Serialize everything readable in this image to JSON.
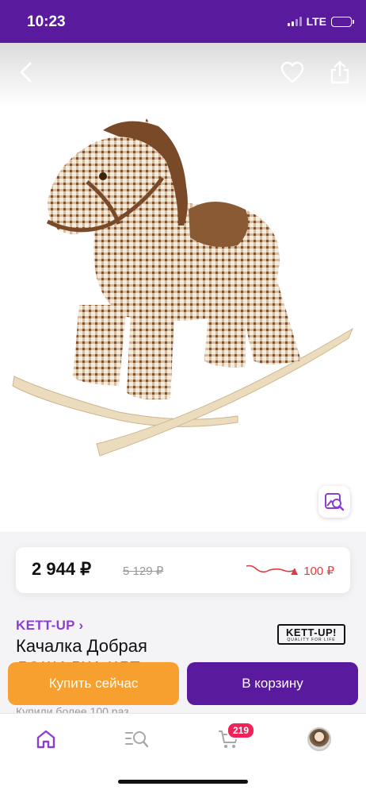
{
  "status_bar": {
    "time": "10:23",
    "network": "LTE"
  },
  "product": {
    "brand": "KETT-UP ›",
    "title": "Качалка Добрая\nЛОШАДКА КЛЕ...",
    "brand_logo_text": "KETT-UP!",
    "brand_logo_tagline": "QUALITY FOR LIFE",
    "bought_text": "Купили более 100 раз"
  },
  "price": {
    "current": "2 944 ₽",
    "old": "5 129 ₽",
    "change": "▲ 100 ₽",
    "change_color": "#e23a3a"
  },
  "actions": {
    "buy_now": "Купить сейчас",
    "add_to_cart": "В корзину"
  },
  "tabbar": {
    "cart_badge": "219"
  },
  "colors": {
    "brand_purple": "#5a1a9e",
    "buy_orange": "#f79f2f",
    "accent_purple": "#8a3fd1",
    "badge_pink": "#f0225a"
  },
  "icons": [
    "back-icon",
    "heart-icon",
    "share-icon",
    "visual-search-icon",
    "home-icon",
    "catalog-search-icon",
    "cart-icon",
    "avatar"
  ]
}
